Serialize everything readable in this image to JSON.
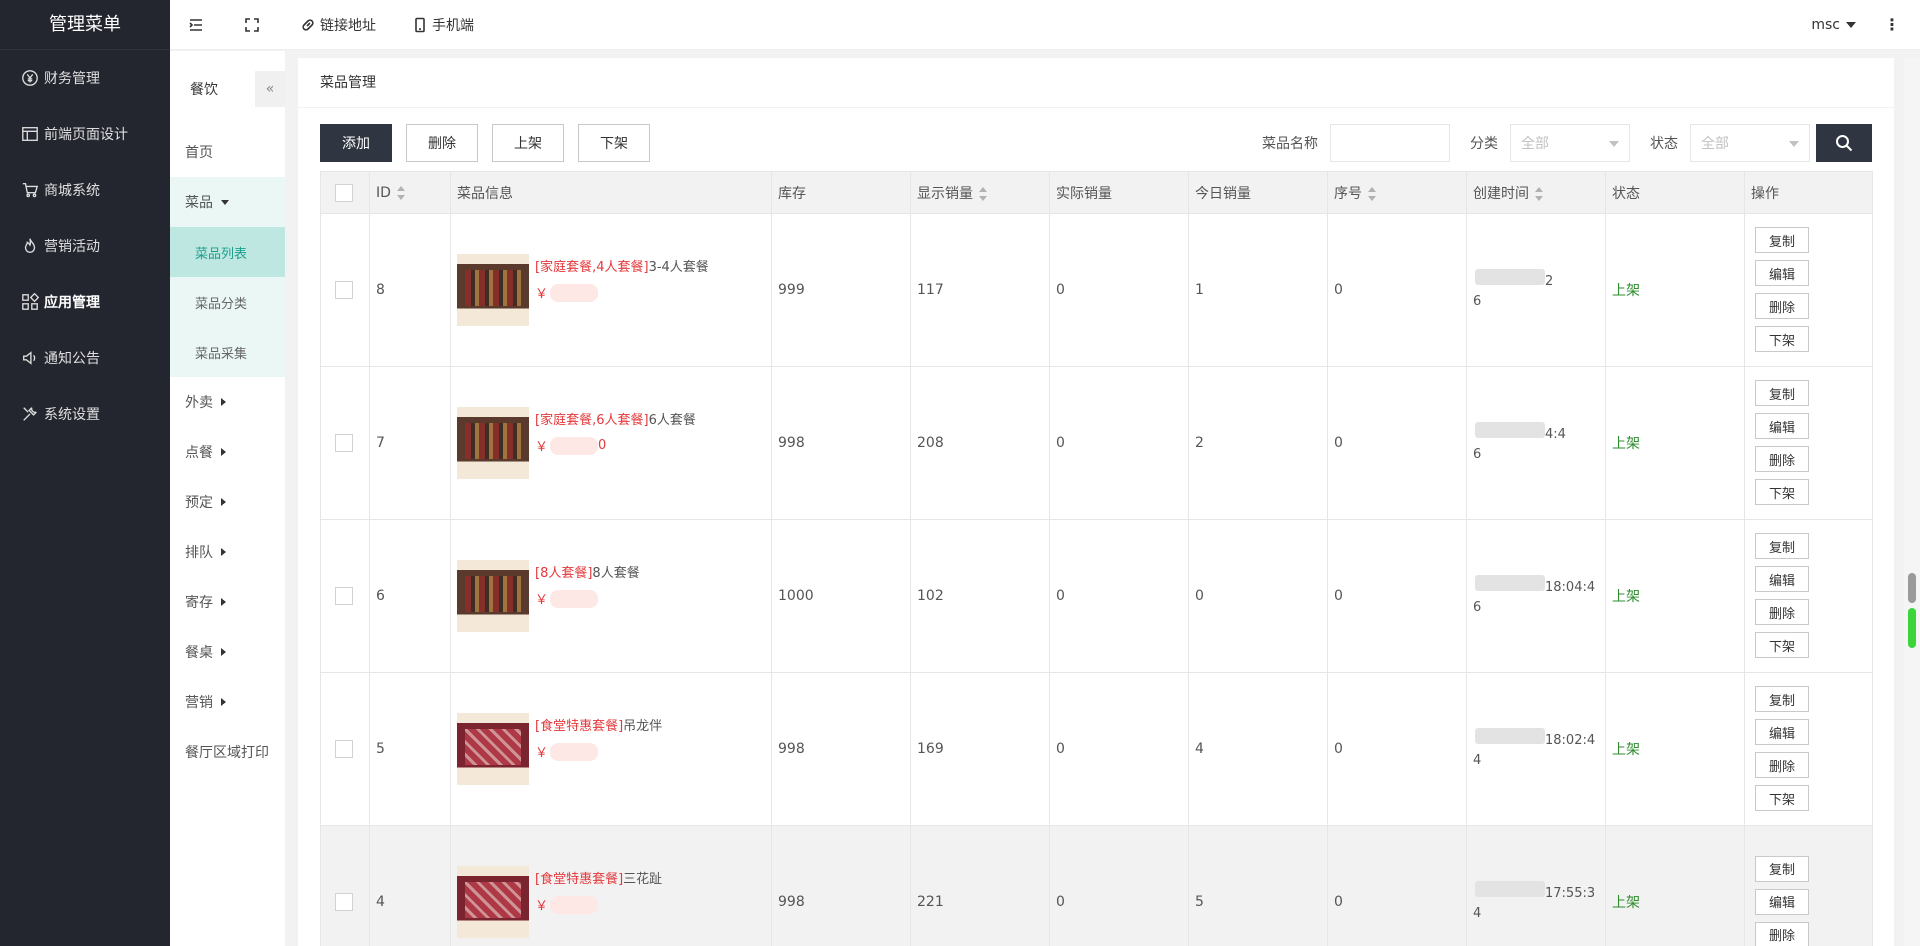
{
  "sidebar": {
    "title": "管理菜单",
    "items": [
      {
        "label": "财务管理",
        "icon": "yen-icon"
      },
      {
        "label": "前端页面设计",
        "icon": "layout-icon"
      },
      {
        "label": "商城系统",
        "icon": "cart-icon"
      },
      {
        "label": "营销活动",
        "icon": "fire-icon"
      },
      {
        "label": "应用管理",
        "icon": "apps-icon"
      },
      {
        "label": "通知公告",
        "icon": "speaker-icon"
      },
      {
        "label": "系统设置",
        "icon": "tools-icon"
      }
    ]
  },
  "header": {
    "link_label": "链接地址",
    "mobile_label": "手机端",
    "user": "msc",
    "more": "⋮"
  },
  "subnav": {
    "title": "餐饮",
    "collapse": "«",
    "items": [
      "首页",
      "菜品",
      "外卖",
      "点餐",
      "预定",
      "排队",
      "寄存",
      "餐桌",
      "营销",
      "餐厅区域打印"
    ],
    "children": [
      "菜品列表",
      "菜品分类",
      "菜品采集"
    ]
  },
  "panel": {
    "title": "菜品管理",
    "buttons": {
      "add": "添加",
      "delete": "删除",
      "on": "上架",
      "off": "下架"
    },
    "filters": {
      "name_label": "菜品名称",
      "category_label": "分类",
      "category_value": "全部",
      "status_label": "状态",
      "status_value": "全部"
    }
  },
  "table": {
    "headers": [
      "ID",
      "菜品信息",
      "库存",
      "显示销量",
      "实际销量",
      "今日销量",
      "序号",
      "创建时间",
      "状态",
      "操作"
    ],
    "ops": [
      "复制",
      "编辑",
      "删除",
      "下架"
    ],
    "rows": [
      {
        "id": "8",
        "tag": "[家庭套餐,4人套餐]",
        "name": "3-4人套餐",
        "price": "￥",
        "stock": "999",
        "shown": "117",
        "actual": "0",
        "today": "1",
        "order": "0",
        "time_a": "2",
        "time_b": "6",
        "status": "上架"
      },
      {
        "id": "7",
        "tag": "[家庭套餐,6人套餐]",
        "name": "6人套餐",
        "price": "￥",
        "price_tail": "0",
        "stock": "998",
        "shown": "208",
        "actual": "0",
        "today": "2",
        "order": "0",
        "time_a": "4:4",
        "time_b": "6",
        "status": "上架"
      },
      {
        "id": "6",
        "tag": "[8人套餐]",
        "name": "8人套餐",
        "price": "￥",
        "stock": "1000",
        "shown": "102",
        "actual": "0",
        "today": "0",
        "order": "0",
        "time_a": "18:04:4",
        "time_b": "6",
        "status": "上架"
      },
      {
        "id": "5",
        "tag": "[食堂特惠套餐]",
        "name": "吊龙伴",
        "price": "￥",
        "stock": "998",
        "shown": "169",
        "actual": "0",
        "today": "4",
        "order": "0",
        "time_a": "18:02:4",
        "time_b": "4",
        "status": "上架"
      },
      {
        "id": "4",
        "tag": "[食堂特惠套餐]",
        "name": "三花趾",
        "price": "￥",
        "stock": "998",
        "shown": "221",
        "actual": "0",
        "today": "5",
        "order": "0",
        "time_a": "17:55:3",
        "time_b": "4",
        "status": "上架"
      }
    ]
  }
}
